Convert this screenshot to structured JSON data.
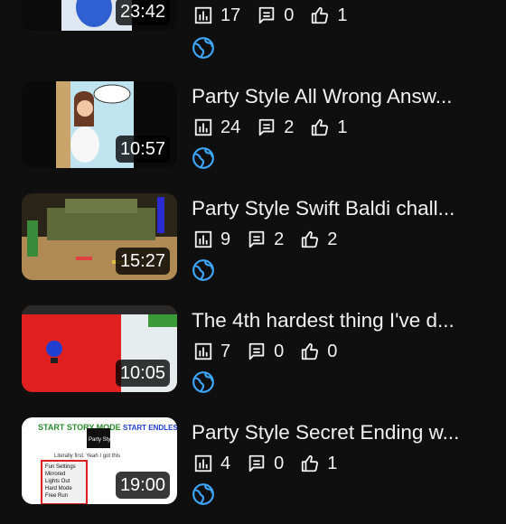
{
  "videos": [
    {
      "title": "",
      "duration": "23:42",
      "views": "17",
      "comments": "0",
      "likes": "1"
    },
    {
      "title": "Party Style All Wrong Answ...",
      "duration": "10:57",
      "views": "24",
      "comments": "2",
      "likes": "1"
    },
    {
      "title": "Party Style Swift Baldi chall...",
      "duration": "15:27",
      "views": "9",
      "comments": "2",
      "likes": "2"
    },
    {
      "title": "The 4th hardest thing I've d...",
      "duration": "10:05",
      "views": "7",
      "comments": "0",
      "likes": "0"
    },
    {
      "title": "Party Style Secret Ending w...",
      "duration": "19:00",
      "views": "4",
      "comments": "0",
      "likes": "1"
    }
  ],
  "thumb_texts": {
    "start_story_mode": "START STORY MODE",
    "party_style": "Party Style",
    "start_endless_mode": "START ENDLESS MODE",
    "first_line": "Literally first. Yeah I got this",
    "menu": [
      "Fun Settings",
      "Mirrored",
      "Lights Out",
      "Hard Mode",
      "Free Run"
    ]
  },
  "colors": {
    "accent": "#3ea6ff",
    "background": "#0f0f0f",
    "text": "#f1f1f1"
  },
  "icons": {
    "views": "analytics-icon",
    "comments": "comment-icon",
    "likes": "thumb-up-icon",
    "visibility": "public-globe-icon"
  }
}
